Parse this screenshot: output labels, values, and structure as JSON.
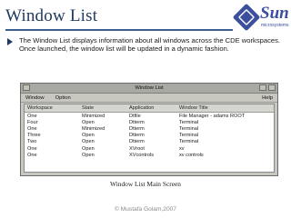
{
  "slide": {
    "title": "Window List",
    "bullet": "The Window List displays information about all windows across the CDE workspaces. Once launched, the window list will be updated in a dynamic fashion.",
    "caption": "Window List Main Screen",
    "footer": "© Mustafa Golam,2007"
  },
  "logo": {
    "word": "Sun",
    "sub": "microsystems",
    "color": "#3b4f9c"
  },
  "window": {
    "title": "Window List",
    "menu": [
      "Window",
      "Option"
    ],
    "help": "Help",
    "columns": [
      "Workspace",
      "State",
      "Application",
      "Window Title"
    ],
    "rows": [
      [
        "One",
        "Minimized",
        "Dtfile",
        "File Manager - adams ROOT"
      ],
      [
        "Four",
        "Open",
        "Dtterm",
        "Terminal"
      ],
      [
        "One",
        "Minimized",
        "Dtterm",
        "Terminal"
      ],
      [
        "Three",
        "Open",
        "Dtterm",
        "Terminal"
      ],
      [
        "Two",
        "Open",
        "Dtterm",
        "Terminal"
      ],
      [
        "One",
        "Open",
        "XVroot",
        "xv"
      ],
      [
        "One",
        "Open",
        "XVcontrols",
        "xv controls"
      ]
    ]
  },
  "colors": {
    "accent": "#1f3a60",
    "rule": "#3a5f8f",
    "window_bg": "#c8c8c0"
  }
}
